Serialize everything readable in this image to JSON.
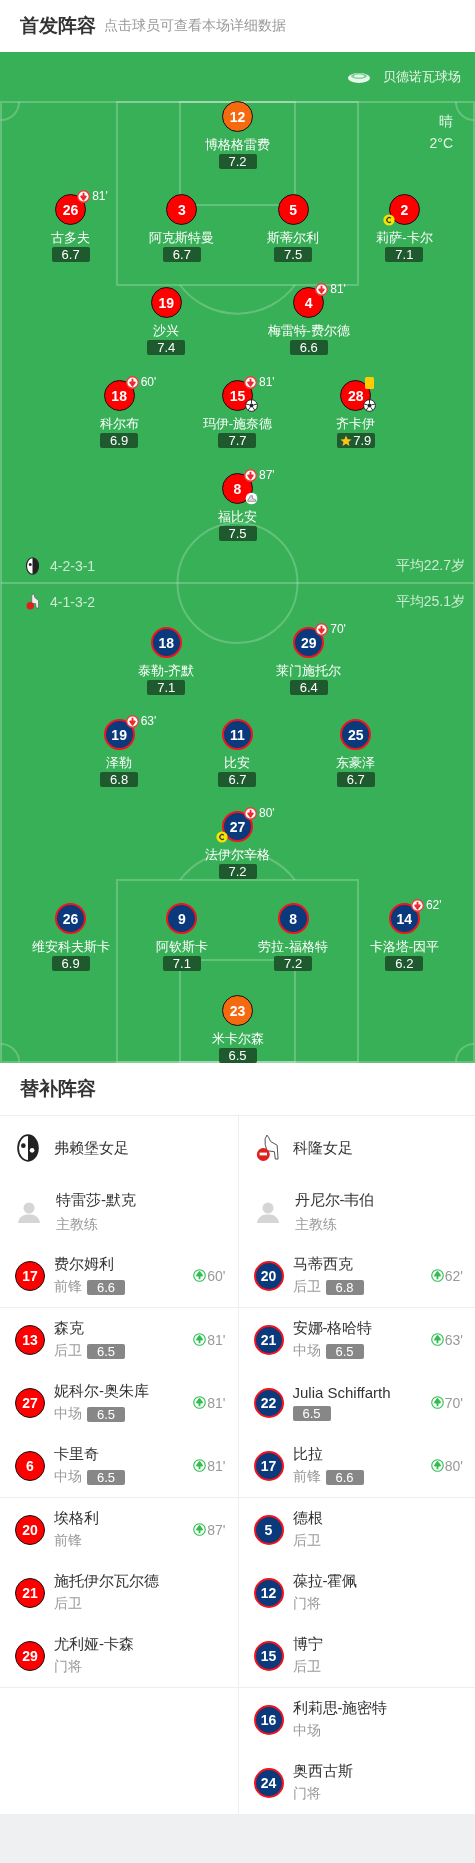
{
  "header": {
    "title": "首发阵容",
    "hint": "点击球员可查看本场详细数据"
  },
  "pitch": {
    "stadium": "贝德诺瓦球场",
    "weather": "晴",
    "temperature": "2°C",
    "teams": [
      {
        "kind": "home",
        "formation": "4-2-3-1",
        "average_age": "平均22.7岁",
        "rows": [
          {
            "players": [
              {
                "number": "12",
                "name": "博格格雷费",
                "rating": "7.2",
                "kind": "goalkeeper"
              }
            ]
          },
          {
            "players": [
              {
                "number": "26",
                "name": "古多夫",
                "rating": "6.7",
                "kind": "outfield",
                "subbed_off": "81'"
              },
              {
                "number": "3",
                "name": "阿克斯特曼",
                "rating": "6.7",
                "kind": "outfield"
              },
              {
                "number": "5",
                "name": "斯蒂尔利",
                "rating": "7.5",
                "kind": "outfield"
              },
              {
                "number": "2",
                "name": "莉萨-卡尔",
                "rating": "7.1",
                "kind": "outfield",
                "captain": true
              }
            ]
          },
          {
            "players": [
              {
                "number": "19",
                "name": "沙兴",
                "rating": "7.4",
                "kind": "outfield"
              },
              {
                "number": "4",
                "name": "梅雷特-费尔德",
                "rating": "6.6",
                "kind": "outfield",
                "subbed_off": "81'"
              }
            ]
          },
          {
            "players": [
              {
                "number": "18",
                "name": "科尔布",
                "rating": "6.9",
                "kind": "outfield",
                "subbed_off": "60'"
              },
              {
                "number": "15",
                "name": "玛伊-施奈德",
                "rating": "7.7",
                "kind": "outfield",
                "subbed_off": "81'",
                "goal": true
              },
              {
                "number": "28",
                "name": "齐卡伊",
                "rating": "7.9",
                "kind": "outfield",
                "yellow_card": true,
                "goal": true,
                "best_player": true
              }
            ]
          },
          {
            "players": [
              {
                "number": "8",
                "name": "福比安",
                "rating": "7.5",
                "kind": "outfield",
                "subbed_off": "87'",
                "assist": true
              }
            ]
          }
        ]
      },
      {
        "kind": "away",
        "formation": "4-1-3-2",
        "average_age": "平均25.1岁",
        "rows": [
          {
            "players": [
              {
                "number": "18",
                "name": "泰勒-齐默",
                "rating": "7.1",
                "kind": "outfield"
              },
              {
                "number": "29",
                "name": "莱门施托尔",
                "rating": "6.4",
                "kind": "outfield",
                "subbed_off": "70'"
              }
            ]
          },
          {
            "players": [
              {
                "number": "19",
                "name": "泽勒",
                "rating": "6.8",
                "kind": "outfield",
                "subbed_off": "63'"
              },
              {
                "number": "11",
                "name": "比安",
                "rating": "6.7",
                "kind": "outfield"
              },
              {
                "number": "25",
                "name": "东豪泽",
                "rating": "6.7",
                "kind": "outfield"
              }
            ]
          },
          {
            "players": [
              {
                "number": "27",
                "name": "法伊尔辛格",
                "rating": "7.2",
                "kind": "outfield",
                "subbed_off": "80'",
                "captain": true
              }
            ]
          },
          {
            "players": [
              {
                "number": "26",
                "name": "维安科夫斯卡",
                "rating": "6.9",
                "kind": "outfield"
              },
              {
                "number": "9",
                "name": "阿钦斯卡",
                "rating": "7.1",
                "kind": "outfield"
              },
              {
                "number": "8",
                "name": "劳拉-福格特",
                "rating": "7.2",
                "kind": "outfield"
              },
              {
                "number": "14",
                "name": "卡洛塔-因平",
                "rating": "6.2",
                "kind": "outfield",
                "subbed_off": "62'"
              }
            ]
          },
          {
            "players": [
              {
                "number": "23",
                "name": "米卡尔森",
                "rating": "6.5",
                "kind": "goalkeeper"
              }
            ]
          }
        ]
      }
    ]
  },
  "bench": {
    "title": "替补阵容",
    "teams": [
      {
        "kind": "home",
        "name": "弗赖堡女足",
        "coach": "特雷莎-默克",
        "coach_role": "主教练"
      },
      {
        "kind": "away",
        "name": "科隆女足",
        "coach": "丹尼尔-韦伯",
        "coach_role": "主教练"
      }
    ],
    "groups": [
      {
        "home": [
          {
            "number": "17",
            "name": "费尔姆利",
            "position": "前锋",
            "rating": "6.6",
            "sub_on": "60'"
          }
        ],
        "away": [
          {
            "number": "20",
            "name": "马蒂西克",
            "position": "后卫",
            "rating": "6.8",
            "sub_on": "62'"
          }
        ]
      },
      {
        "home": [
          {
            "number": "13",
            "name": "森克",
            "position": "后卫",
            "rating": "6.5",
            "sub_on": "81'"
          },
          {
            "number": "27",
            "name": "妮科尔-奥朱库",
            "position": "中场",
            "rating": "6.5",
            "sub_on": "81'"
          },
          {
            "number": "6",
            "name": "卡里奇",
            "position": "中场",
            "rating": "6.5",
            "sub_on": "81'"
          }
        ],
        "away": [
          {
            "number": "21",
            "name": "安娜-格哈特",
            "position": "中场",
            "rating": "6.5",
            "sub_on": "63'"
          },
          {
            "number": "22",
            "name": "Julia Schiffarth",
            "rating": "6.5",
            "sub_on": "70'"
          },
          {
            "number": "17",
            "name": "比拉",
            "position": "前锋",
            "rating": "6.6",
            "sub_on": "80'"
          }
        ]
      },
      {
        "home": [
          {
            "number": "20",
            "name": "埃格利",
            "position": "前锋",
            "sub_on": "87'"
          },
          {
            "number": "21",
            "name": "施托伊尔瓦尔德",
            "position": "后卫"
          },
          {
            "number": "29",
            "name": "尤利娅-卡森",
            "position": "门将"
          }
        ],
        "away": [
          {
            "number": "5",
            "name": "德根",
            "position": "后卫"
          },
          {
            "number": "12",
            "name": "葆拉-霍佩",
            "position": "门将"
          },
          {
            "number": "15",
            "name": "博宁",
            "position": "后卫"
          }
        ]
      },
      {
        "away": [
          {
            "number": "16",
            "name": "利莉思-施密特",
            "position": "中场"
          },
          {
            "number": "24",
            "name": "奥西古斯",
            "position": "门将"
          }
        ]
      }
    ]
  }
}
